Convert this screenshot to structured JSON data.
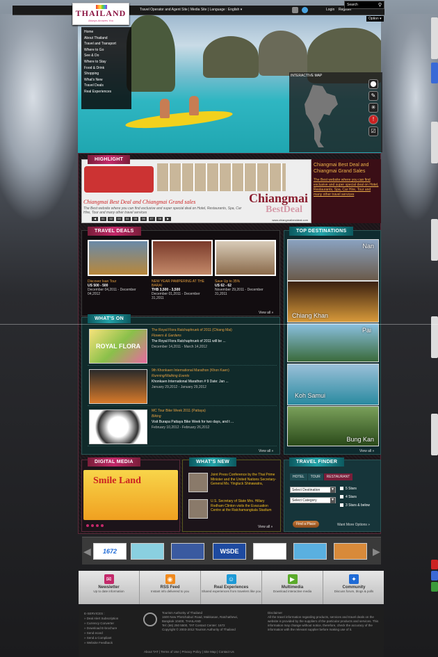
{
  "topbar": {
    "links": "Travel Operator and Agent Site | Media Site | Language : English ▾",
    "login": "Login",
    "register": "Register",
    "search_placeholder": "Search",
    "option": "Option ▾"
  },
  "logo": {
    "title": "THAILAND",
    "tagline": "Always Amazes You"
  },
  "menu": [
    "Home",
    "About Thailand",
    "Travel and Transport",
    "Where to Go",
    "See & Do",
    "Where to Stay",
    "Food & Drink",
    "Shopping",
    "What's New",
    "Travel Deals",
    "Real Experiences"
  ],
  "map": {
    "label": "INTERACTIVE MAP"
  },
  "highlight": {
    "title": "HIGHLIGHT",
    "caption": "Chiangmai Best Deal and Chiangmai Grand sales",
    "subcaption": "The Best website where you can find exclusive and super special deal on Hotel, Restaurants, Spa, Car Hire, Tour and many other travel services",
    "logo_top": "Chiangmai",
    "logo_bottom": "BestDeal",
    "url": "www.chiangmaibestdeal.com",
    "pager": [
      "01",
      "02",
      "03",
      "04",
      "05",
      "06",
      "07",
      "08"
    ],
    "side_title": "Chiangmai Best Deal and Chiangmai Grand Sales",
    "side_text": "The Best website where you can find exclusive and super special deal on Hotel, Restaurants, Spa, Car Hire, Tour and many other travel services"
  },
  "travel_deals": {
    "title": "TRAVEL DEALS",
    "view_all": "View all »",
    "cards": [
      {
        "title": "Discover Isan Tour",
        "price": "US 500 - 500",
        "date": "December 04,2011 - December 04,2012"
      },
      {
        "title": "NEW YEAR PAMPERING AT THE BARAI",
        "price": "THB 3,500 - 3,500",
        "date": "December 01,2011 - December 31,2011"
      },
      {
        "title": "Save Up to 35%",
        "price": "US 62 - 62",
        "date": "November 29,2011 - December 31,2011"
      }
    ]
  },
  "whats_on": {
    "title": "WHAT'S ON",
    "view_all": "View all »",
    "items": [
      {
        "title": "The Royal Flora Ratchaphruek of 2011 (Chiang Mai)",
        "category": "Flowers & Gardens",
        "blurb": "The Royal Flora Ratchaphruek of 2011 will be ...",
        "date": "December 14,2011 - March 14,2012",
        "img_text": "ROYAL FLORA"
      },
      {
        "title": "9th Khonkaen International Marathon (Khon Kaen)",
        "category": "Running/Walking Events",
        "blurb": "Khonkaen International Marathon # 9 Date: Jan ...",
        "date": "January 29,2012 - January 29,2012",
        "img_text": ""
      },
      {
        "title": "MC Tour Bike Week 2011 (Pattaya)",
        "category": "Biking",
        "blurb": "Visit Burapa Pattaya Bike Week for two days, and t ...",
        "date": "February 10,2012 - February 26,2012",
        "img_text": ""
      }
    ]
  },
  "destinations": {
    "title": "TOP DESTINATIONS",
    "view_all": "View all »",
    "items": [
      "Nan",
      "Chiang Khan",
      "Pai",
      "Koh Samui",
      "Bung Kan"
    ]
  },
  "digital_media": {
    "title": "DIGITAL MEDIA",
    "img_text": "Smile Land"
  },
  "whats_new": {
    "title": "WHAT'S NEW",
    "view_all": "View all »",
    "items": [
      "Joint Press Conference by the Thai Prime Minister and the United Nations Secretary-General Ms. Yingluck Shinawatra,",
      "U.S. Secretary of State Mrs. Hillary Rodham Clinton visits the Evacuation Centre at the Ratchamangkala Stadium"
    ]
  },
  "travel_finder": {
    "title": "TRAVEL FINDER",
    "tabs": [
      "HOTEL",
      "TOUR",
      "RESTAURANT"
    ],
    "destination": "Select Destination",
    "category": "Select Category",
    "stars": [
      "5 Stars",
      "4 Stars",
      "3 Stars & below"
    ],
    "button": "Find a Place",
    "more": "Want More Options »"
  },
  "partners": [
    "1672",
    "",
    "",
    "WSDE",
    "",
    "",
    ""
  ],
  "features": [
    {
      "title": "Newsletter",
      "sub": "Up to date information",
      "color": "#c4296a",
      "icon": "newsletter-icon",
      "glyph": "✉"
    },
    {
      "title": "RSS Feed",
      "sub": "Instant info delivered to you",
      "color": "#f08a1e",
      "icon": "rss-icon",
      "glyph": "◉"
    },
    {
      "title": "Real Experiences",
      "sub": "Shared experiences from travelers like you",
      "color": "#1e9ad6",
      "icon": "person-icon",
      "glyph": "☺"
    },
    {
      "title": "Multimedia",
      "sub": "Download interactive media",
      "color": "#5aaa2a",
      "icon": "media-icon",
      "glyph": "▶"
    },
    {
      "title": "Community",
      "sub": "Discuss forum, blogs & polls",
      "color": "#1e6ad6",
      "icon": "community-icon",
      "glyph": "✦"
    }
  ],
  "footer": {
    "services": [
      "E-SERVICES :",
      "» Deal Alert Subscription",
      "» Currency Converter",
      "» Download E-brochure",
      "» Send ecard",
      "» Send a Compliant",
      "» Website Feedback"
    ],
    "tat_lines": [
      "Tourism Authority of Thailand",
      "1600 New Phetchaburi Road, Makkasan, Ratchathewi,",
      "Bangkok 10400, THAILAND",
      "Tel: (66) 250 5500, TAT Contact Center: 1672",
      "Copyright © 2003-2012 Tourism Authority of Thailand"
    ],
    "disclaimer": "Disclaimer",
    "disclaimer_text": "All the travel information regarding products, services and travel deals on the website is provided by the suppliers of the particular products and services. This information may change without notice, therefore, check the accuracy of the information with the relevant supplier before making use of it.",
    "bottom": "About TAT | Terms of Use | Privacy Policy | Site Map | Contact Us"
  }
}
